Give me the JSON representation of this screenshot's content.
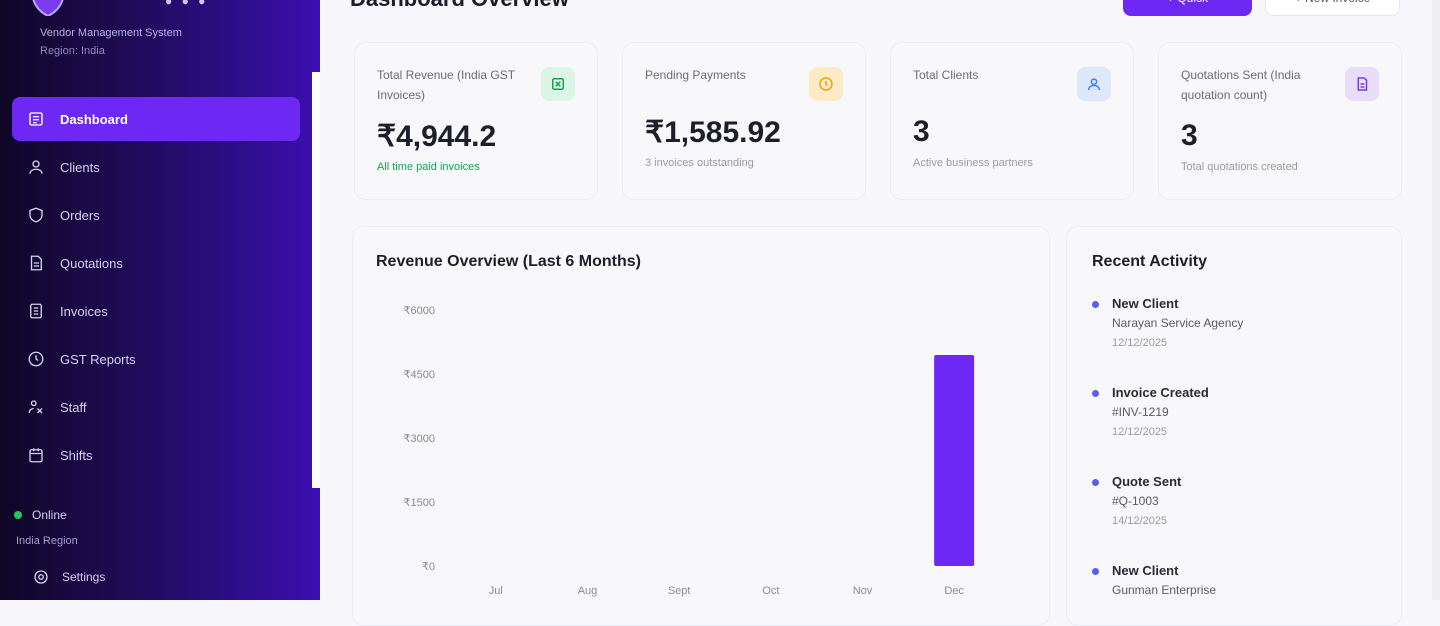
{
  "sidebar": {
    "subtitle": "Vendor Management System",
    "user_line": "Region: India",
    "nav": [
      {
        "label": "Dashboard",
        "icon": "dashboard-icon",
        "active": true
      },
      {
        "label": "Clients",
        "icon": "user-icon"
      },
      {
        "label": "Orders",
        "icon": "shield-icon"
      },
      {
        "label": "Quotations",
        "icon": "document-icon"
      },
      {
        "label": "Invoices",
        "icon": "invoice-icon"
      },
      {
        "label": "GST Reports",
        "icon": "clock-icon"
      },
      {
        "label": "Staff",
        "icon": "staff-icon"
      },
      {
        "label": "Shifts",
        "icon": "calendar-icon"
      }
    ],
    "status": "Online",
    "user_name": "India Region",
    "settings_label": "Settings"
  },
  "header": {
    "title": "Dashboard Overview",
    "primary_button": "+ Quick",
    "secondary_button": "+ New Invoice"
  },
  "stats": [
    {
      "label": "Total Revenue (India GST Invoices)",
      "value": "₹4,944.2",
      "sub": "All time paid invoices",
      "icon": "rupee-icon",
      "icon_bg": "#dcf5e6",
      "icon_color": "#16a34a"
    },
    {
      "label": "Pending Payments",
      "value": "₹1,585.92",
      "sub": "3 invoices outstanding",
      "icon": "clock-icon",
      "icon_bg": "#fdebc8",
      "icon_color": "#f59e0b"
    },
    {
      "label": "Total Clients",
      "value": "3",
      "sub": "Active business partners",
      "icon": "users-icon",
      "icon_bg": "#dde8fb",
      "icon_color": "#3b82f6"
    },
    {
      "label": "Quotations Sent (India quotation count)",
      "value": "3",
      "sub": "Total quotations created",
      "icon": "document-icon",
      "icon_bg": "#e8defb",
      "icon_color": "#7c3aed"
    }
  ],
  "chart_data": {
    "type": "bar",
    "title": "Revenue Overview (Last 6 Months)",
    "categories": [
      "Jul",
      "Aug",
      "Sept",
      "Oct",
      "Nov",
      "Dec"
    ],
    "values": [
      0,
      0,
      0,
      0,
      0,
      4944.2
    ],
    "y_ticks": [
      "₹6000",
      "₹4500",
      "₹3000",
      "₹1500",
      "₹0"
    ],
    "ylim": [
      0,
      6000
    ],
    "bar_color": "#6d28f4"
  },
  "activity": {
    "title": "Recent Activity",
    "items": [
      {
        "title": "New Client",
        "detail": "Narayan Service Agency",
        "date": "12/12/2025"
      },
      {
        "title": "Invoice Created",
        "detail": "#INV-1219",
        "date": "12/12/2025"
      },
      {
        "title": "Quote Sent",
        "detail": "#Q-1003",
        "date": "14/12/2025"
      },
      {
        "title": "New Client",
        "detail": "Gunman Enterprise",
        "date": ""
      }
    ]
  }
}
